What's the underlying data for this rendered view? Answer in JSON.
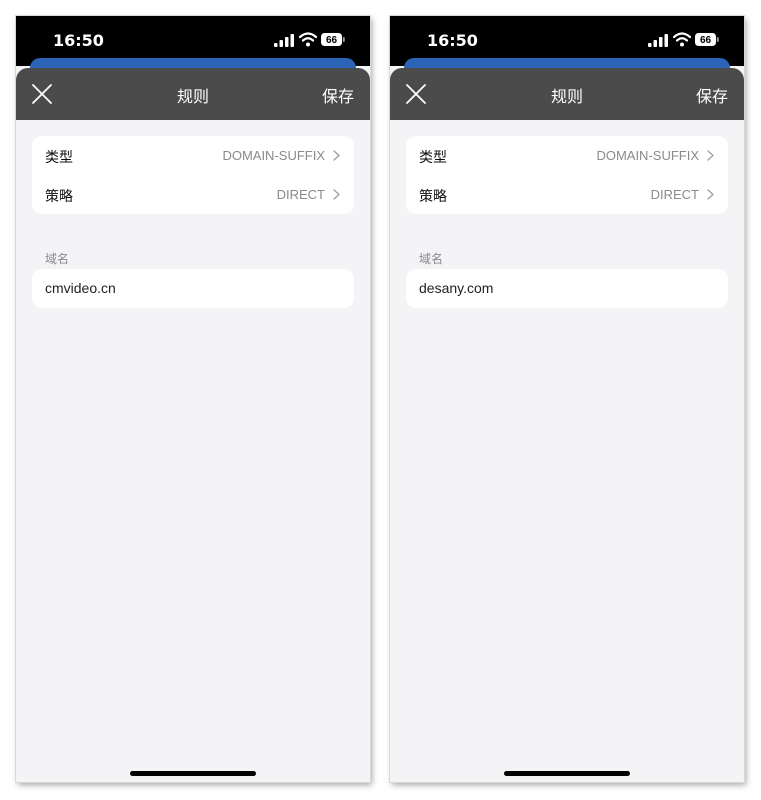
{
  "screens": [
    {
      "status": {
        "time": "16:50",
        "battery": "66"
      },
      "header": {
        "title": "规则",
        "save_label": "保存"
      },
      "settings": [
        {
          "label": "类型",
          "value": "DOMAIN-SUFFIX"
        },
        {
          "label": "策略",
          "value": "DIRECT"
        }
      ],
      "domain_section_label": "域名",
      "domain_value": "cmvideo.cn"
    },
    {
      "status": {
        "time": "16:50",
        "battery": "66"
      },
      "header": {
        "title": "规则",
        "save_label": "保存"
      },
      "settings": [
        {
          "label": "类型",
          "value": "DOMAIN-SUFFIX"
        },
        {
          "label": "策略",
          "value": "DIRECT"
        }
      ],
      "domain_section_label": "域名",
      "domain_value": "desany.com"
    }
  ],
  "colors": {
    "status_bar": "#000000",
    "header_bar": "#4b4b4b",
    "accent_blue": "#2b63b6",
    "background": "#f4f4f6",
    "secondary_text": "#8a8a8e"
  }
}
